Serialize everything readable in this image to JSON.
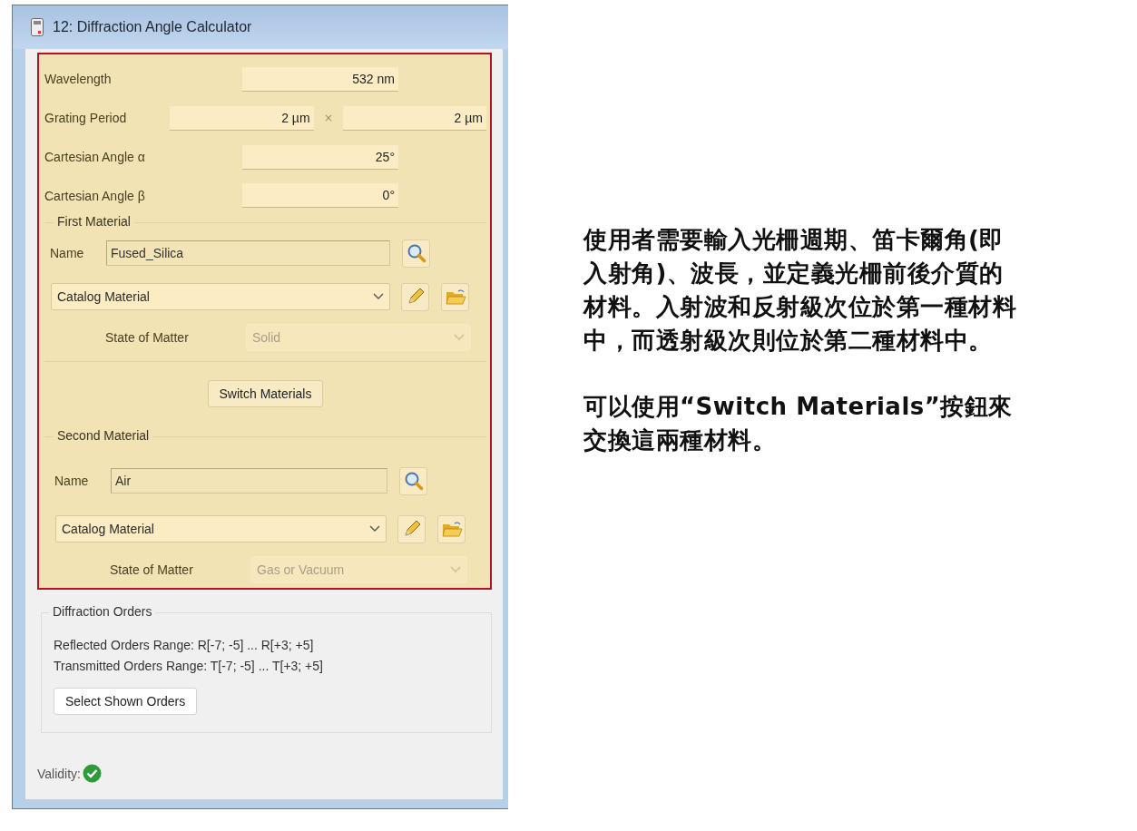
{
  "window": {
    "title": "12: Diffraction Angle Calculator"
  },
  "parameters": [
    {
      "kind": "single",
      "label": "Wavelength",
      "values": [
        "532 nm"
      ]
    },
    {
      "kind": "pair",
      "label": "Grating Period",
      "values": [
        "2 µm",
        "2 µm"
      ],
      "separator": "×"
    },
    {
      "kind": "single",
      "label": "Cartesian Angle α",
      "values": [
        "25°"
      ]
    },
    {
      "kind": "single",
      "label": "Cartesian Angle β",
      "values": [
        "0°"
      ]
    }
  ],
  "materials": [
    {
      "title": "First Material",
      "name_label": "Name",
      "name": "Fused_Silica",
      "type": "Catalog Material",
      "state_label": "State of Matter",
      "state": "Solid",
      "state_disabled": true
    },
    {
      "title": "Second Material",
      "name_label": "Name",
      "name": "Air",
      "type": "Catalog Material",
      "state_label": "State of Matter",
      "state": "Gas or Vacuum",
      "state_disabled": true
    }
  ],
  "switch_button": "Switch Materials",
  "diffraction_orders": {
    "title": "Diffraction Orders",
    "lines": [
      "Reflected Orders Range: R[-7; -5] ... R[+3; +5]",
      "Transmitted Orders Range: T[-7; -5] ... T[+3; +5]"
    ],
    "button": "Select Shown Orders"
  },
  "validity": {
    "label": "Validity:",
    "valid": true
  },
  "annotation": [
    "使用者需要輸入光柵週期、笛卡爾角(即入射角)、波長，並定義光柵前後介質的材料。入射波和反射級次位於第一種材料中，而透射級次則位於第二種材料中。",
    "可以使用“Switch Materials”按鈕來交換這兩種材料。"
  ]
}
